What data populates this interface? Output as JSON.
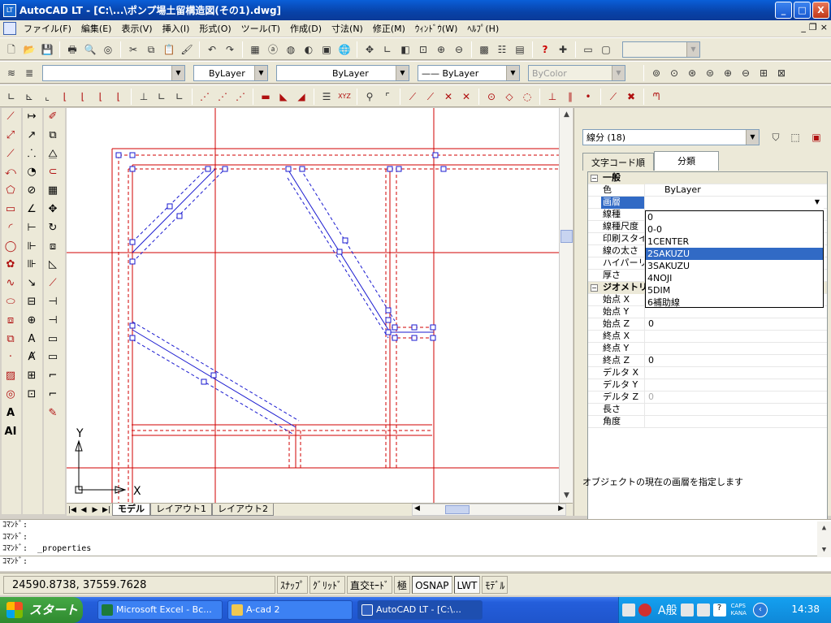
{
  "window": {
    "title": "AutoCAD LT - [C:\\...\\ポンプ場土留構造図(その1).dwg]",
    "icon_text": "LT",
    "min_label": "_",
    "max_label": "□",
    "close_label": "X"
  },
  "menubar": {
    "items": [
      "ファイル(F)",
      "編集(E)",
      "表示(V)",
      "挿入(I)",
      "形式(O)",
      "ツール(T)",
      "作成(D)",
      "寸法(N)",
      "修正(M)",
      "ｳｨﾝﾄﾞｳ(W)",
      "ﾍﾙﾌﾟ(H)"
    ],
    "mdi_min": "_",
    "mdi_restore": "❐",
    "mdi_close": "×"
  },
  "layers_toolbar": {
    "layer_value": "",
    "color_value": "ByLayer",
    "linetype_value": "ByLayer",
    "lineweight_value": "—— ByLayer",
    "plotstyle_value": "ByColor"
  },
  "properties": {
    "selection": "線分 (18)",
    "tab_alpha": "文字コード順",
    "tab_category": "分類",
    "general_header": "一般",
    "geometry_header": "ジオメトリ",
    "rows_general": [
      {
        "key": "色",
        "value": "ByLayer"
      },
      {
        "key": "画層",
        "value": ""
      },
      {
        "key": "線種",
        "value": ""
      },
      {
        "key": "線種尺度",
        "value": ""
      },
      {
        "key": "印刷スタイル",
        "value": ""
      },
      {
        "key": "線の太さ",
        "value": ""
      },
      {
        "key": "ハイパーリンク",
        "value": ""
      },
      {
        "key": "厚さ",
        "value": ""
      }
    ],
    "rows_geometry": [
      {
        "key": "始点 X",
        "value": ""
      },
      {
        "key": "始点 Y",
        "value": ""
      },
      {
        "key": "始点 Z",
        "value": "0"
      },
      {
        "key": "終点 X",
        "value": ""
      },
      {
        "key": "終点 Y",
        "value": ""
      },
      {
        "key": "終点 Z",
        "value": "0"
      },
      {
        "key": "デルタ X",
        "value": ""
      },
      {
        "key": "デルタ Y",
        "value": ""
      },
      {
        "key": "デルタ Z",
        "value": "0"
      },
      {
        "key": "長さ",
        "value": ""
      },
      {
        "key": "角度",
        "value": ""
      }
    ],
    "layer_options": [
      "0",
      "0-0",
      "1CENTER",
      "2SAKUZU",
      "3SAKUZU",
      "4NOJI",
      "5DIM",
      "6補助線"
    ],
    "selected_layer": "2SAKUZU",
    "description": "オブジェクトの現在の画層を指定します"
  },
  "layout_tabs": [
    "モデル",
    "レイアウト1",
    "レイアウト2"
  ],
  "ucs": {
    "x_label": "X",
    "y_label": "Y"
  },
  "command_line": {
    "history": [
      "ｺﾏﾝﾄﾞ:",
      "ｺﾏﾝﾄﾞ:",
      "ｺﾏﾝﾄﾞ:  _properties"
    ],
    "prompt": "ｺﾏﾝﾄﾞ:"
  },
  "status_bar": {
    "coordinates": "24590.8738, 37559.7628",
    "buttons": [
      "ｽﾅｯﾌﾟ",
      "ｸﾞﾘｯﾄﾞ",
      "直交ﾓｰﾄﾞ",
      "極",
      "OSNAP",
      "LWT",
      "ﾓﾃﾞﾙ"
    ]
  },
  "taskbar": {
    "start": "スタート",
    "tasks": [
      "Microsoft Excel - Bc...",
      "A-cad 2",
      "AutoCAD LT - [C:\\..."
    ],
    "ime": "A般",
    "caps": "CAPS",
    "kana": "KANA",
    "clock": "14:38"
  },
  "colors": {
    "drawing_red": "#d00000",
    "drawing_blue": "#1a1ad0",
    "selection_blue": "#316ac5"
  }
}
